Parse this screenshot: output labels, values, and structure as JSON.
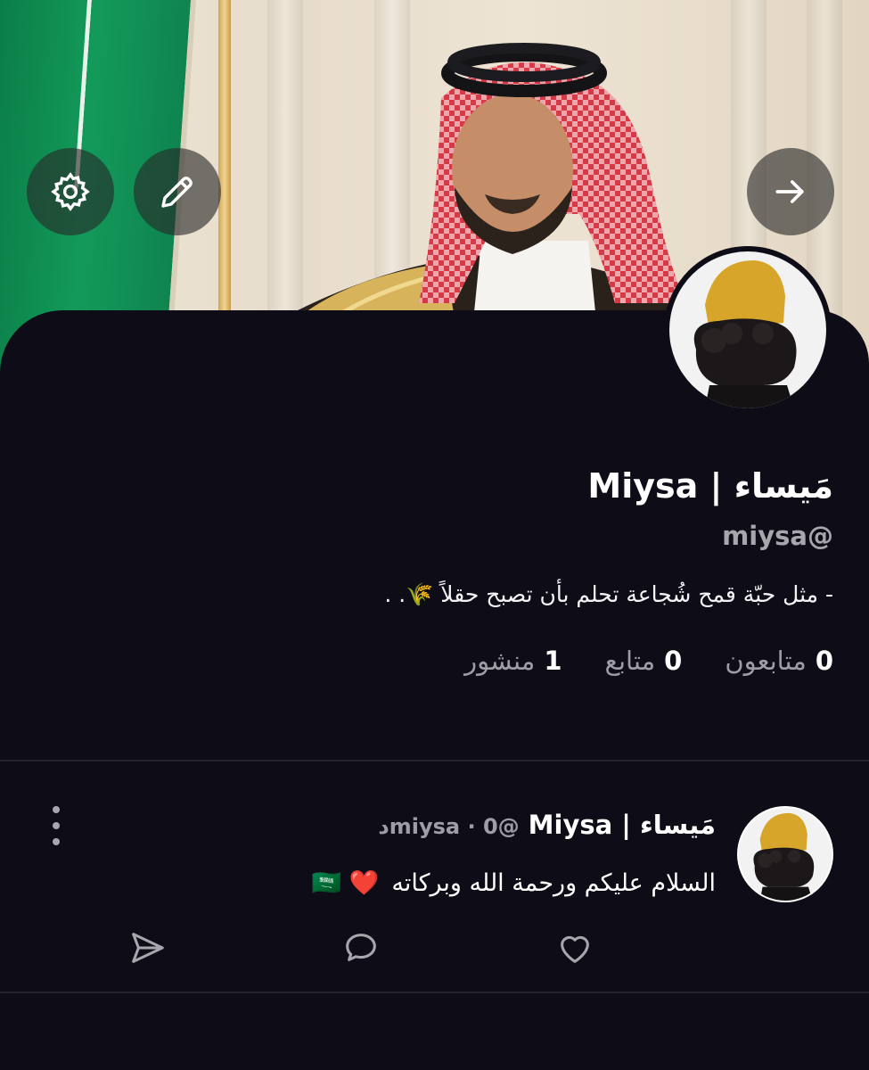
{
  "profile": {
    "display_name": "مَيساء | Miysa",
    "handle": "@miysa",
    "bio": "- مثل حبّة قمح شُجاعة تحلم بأن تصبح حقلاً 🌾. ."
  },
  "stats": {
    "followers_count": "0",
    "followers_label": "متابعون",
    "following_count": "0",
    "following_label": "متابع",
    "posts_count": "1",
    "posts_label": "منشور"
  },
  "post": {
    "author": "مَيساء | Miysa",
    "meta": "@miysa · 0د",
    "text": "السلام عليكم ورحمة الله وبركاته",
    "emojis": "❤️ 🇸🇦"
  },
  "icons": {
    "settings": "gear-icon",
    "edit": "pencil-icon",
    "forward": "arrow-right-icon",
    "menu": "more-vertical-icon",
    "share": "send-icon",
    "reply": "chat-bubble-icon",
    "like": "heart-icon"
  }
}
